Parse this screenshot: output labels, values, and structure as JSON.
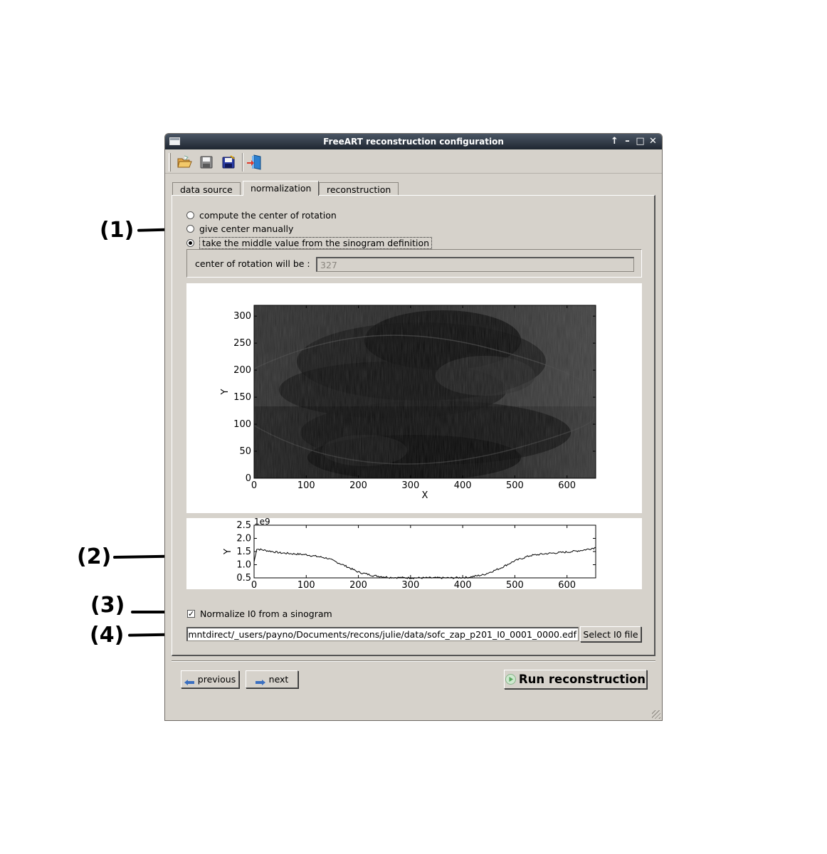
{
  "annotations": {
    "c1": "(1)",
    "c2": "(2)",
    "c3": "(3)",
    "c4": "(4)"
  },
  "window": {
    "title": "FreeART reconstruction configuration",
    "controls": [
      "↑",
      "–",
      "□",
      "✕"
    ]
  },
  "toolbar": {
    "icons": [
      "open-folder-icon",
      "save-icon",
      "save-as-icon",
      "exit-icon"
    ]
  },
  "tabs": [
    {
      "label": "data source",
      "active": false
    },
    {
      "label": "normalization",
      "active": true
    },
    {
      "label": "reconstruction",
      "active": false
    }
  ],
  "center_options": [
    {
      "label": "compute the center of rotation",
      "selected": false
    },
    {
      "label": "give center manually",
      "selected": false
    },
    {
      "label": "take the middle value from the sinogram definition",
      "selected": true
    }
  ],
  "center_field": {
    "label": "center of rotation will be :",
    "value": "327"
  },
  "normalize": {
    "checked": true,
    "label": "Normalize I0 from a sinogram",
    "file_path": "/mntdirect/_users/payno/Documents/recons/julie/data/sofc_zap_p201_I0_0001_0000.edf",
    "select_button": "Select I0 file"
  },
  "footer": {
    "previous_label": "previous",
    "next_label": "next",
    "run_label": "Run reconstruction"
  },
  "chart_data": [
    {
      "type": "heatmap",
      "title": "",
      "xlabel": "X",
      "ylabel": "Y",
      "xlim": [
        0,
        655
      ],
      "ylim": [
        0,
        320
      ],
      "xticks": [
        0,
        100,
        200,
        300,
        400,
        500,
        600
      ],
      "yticks": [
        0,
        50,
        100,
        150,
        200,
        250,
        300
      ],
      "colormap": "gray"
    },
    {
      "type": "line",
      "title": "",
      "xlabel": "",
      "ylabel": "Y",
      "offset_label": "1e9",
      "xlim": [
        0,
        655
      ],
      "ylim": [
        0.5,
        2.5
      ],
      "xticks": [
        0,
        100,
        200,
        300,
        400,
        500,
        600
      ],
      "yticks": [
        0.5,
        1.0,
        1.5,
        2.0,
        2.5
      ],
      "series": [
        {
          "x": [
            0,
            5,
            20,
            50,
            100,
            140,
            170,
            200,
            230,
            260,
            300,
            340,
            380,
            410,
            440,
            470,
            500,
            530,
            560,
            600,
            630,
            655
          ],
          "y": [
            1.1,
            1.6,
            1.55,
            1.45,
            1.38,
            1.25,
            1.0,
            0.72,
            0.58,
            0.52,
            0.5,
            0.5,
            0.5,
            0.52,
            0.62,
            0.85,
            1.15,
            1.35,
            1.42,
            1.48,
            1.55,
            1.65
          ]
        }
      ]
    }
  ]
}
